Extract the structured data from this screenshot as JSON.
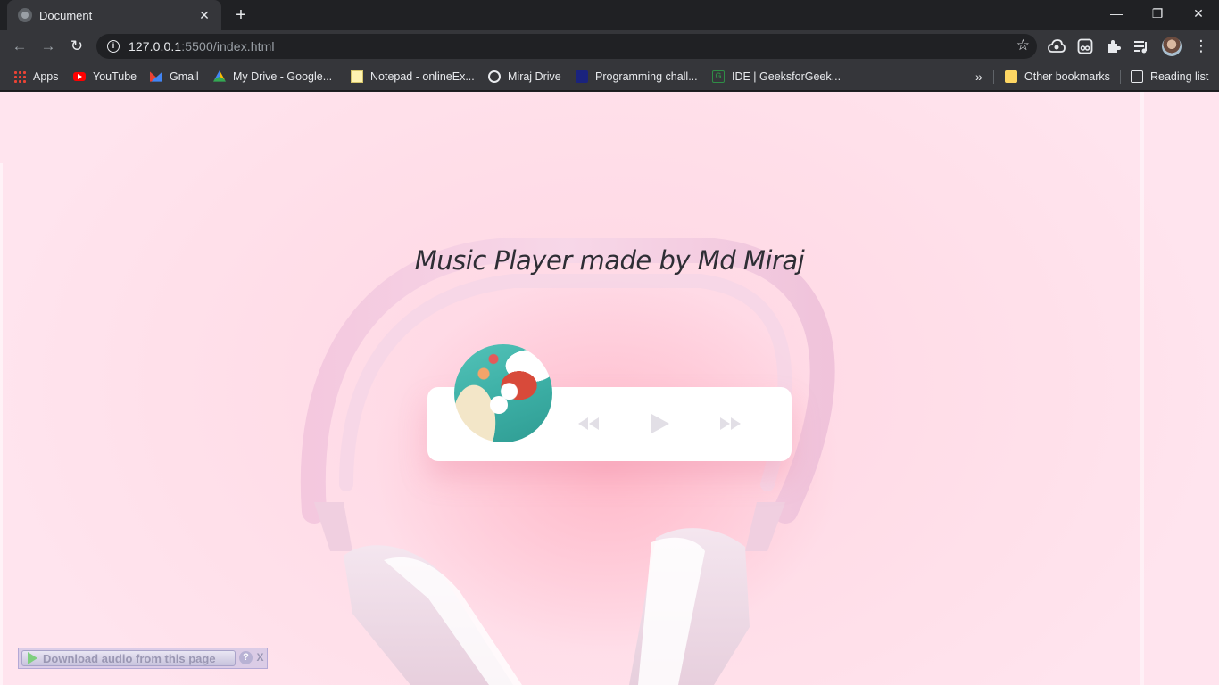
{
  "browser": {
    "tab": {
      "title": "Document",
      "close": "✕"
    },
    "new_tab": "+",
    "window": {
      "minimize": "—",
      "restore": "❐",
      "close": "✕"
    },
    "toolbar": {
      "back": "←",
      "forward": "→",
      "reload": "↻",
      "info": "i",
      "star": "☆",
      "menu": "⋮"
    },
    "url": {
      "host": "127.0.0.1",
      "path": ":5500/index.html"
    },
    "bookmarks": [
      {
        "label": "Apps"
      },
      {
        "label": "YouTube"
      },
      {
        "label": "Gmail"
      },
      {
        "label": "My Drive - Google..."
      },
      {
        "label": "Notepad - onlineEx..."
      },
      {
        "label": "Miraj Drive"
      },
      {
        "label": "Programming chall..."
      },
      {
        "label": "IDE | GeeksforGeek..."
      }
    ],
    "bookmarks_more": "»",
    "other_bookmarks": "Other bookmarks",
    "reading_list": "Reading list"
  },
  "page": {
    "title": "Music Player made by Md Miraj",
    "player": {
      "prev_icon": "rewind-icon",
      "play_icon": "play-icon",
      "next_icon": "fast-forward-icon",
      "control_color": "#e2dfe6"
    },
    "download_widget": {
      "label": "Download audio from this page",
      "help": "?",
      "close": "X"
    }
  }
}
